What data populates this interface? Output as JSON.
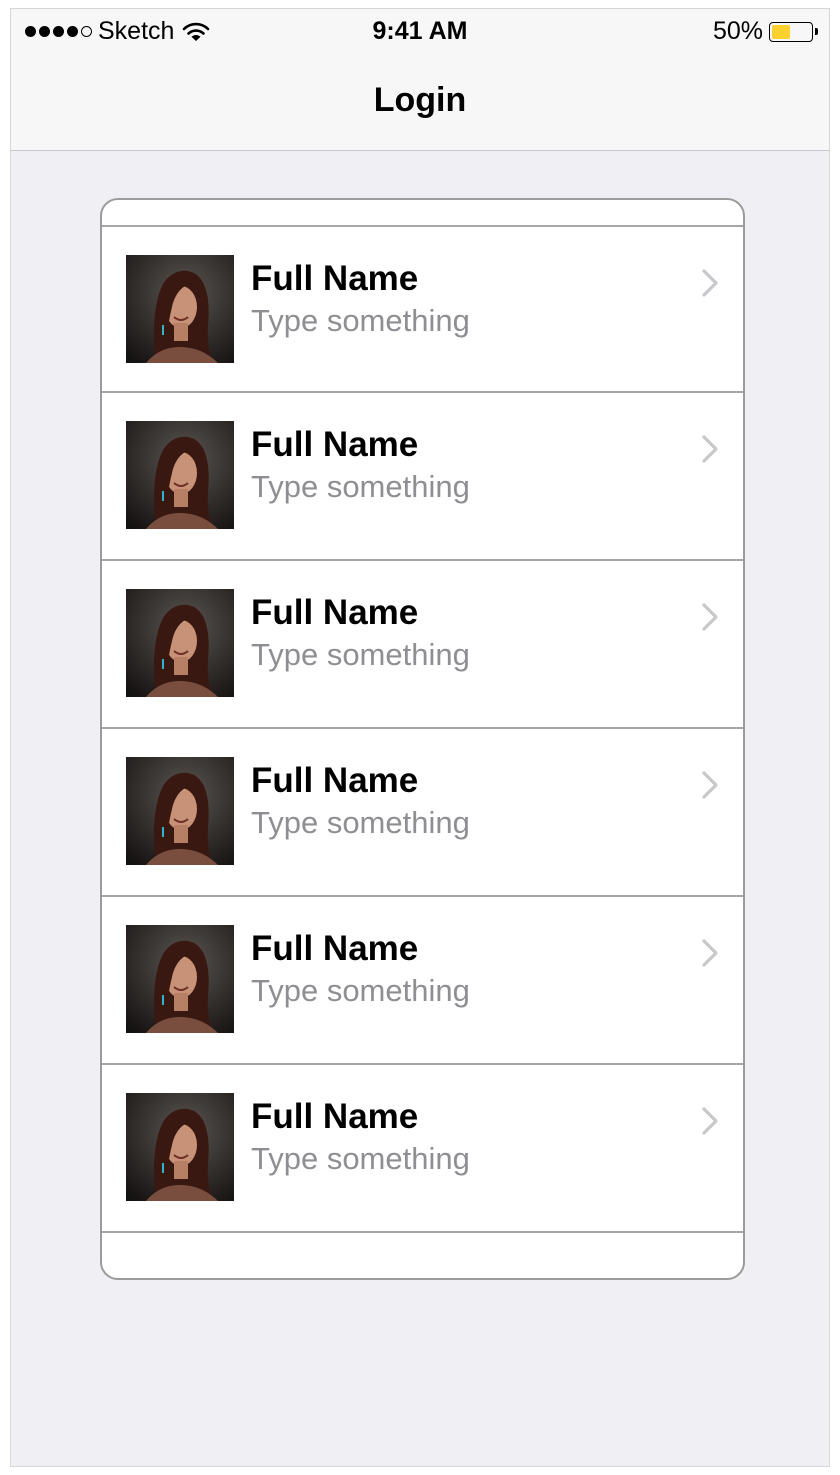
{
  "status_bar": {
    "carrier": "Sketch",
    "time": "9:41 AM",
    "battery_text": "50%",
    "battery_level": 0.5,
    "signal_bars_filled": 4,
    "signal_bars_total": 5,
    "battery_color": "#fcd02f"
  },
  "nav": {
    "title": "Login"
  },
  "list": {
    "items": [
      {
        "title": "Full Name",
        "subtitle": "Type something"
      },
      {
        "title": "Full Name",
        "subtitle": "Type something"
      },
      {
        "title": "Full Name",
        "subtitle": "Type something"
      },
      {
        "title": "Full Name",
        "subtitle": "Type something"
      },
      {
        "title": "Full Name",
        "subtitle": "Type something"
      },
      {
        "title": "Full Name",
        "subtitle": "Type something"
      }
    ]
  },
  "colors": {
    "background": "#efeff4",
    "nav_background": "#f7f7f7",
    "subtitle_text": "#8e8e93",
    "chevron": "#c7c7cc"
  },
  "icons": {
    "row_accessory": "chevron-right-icon",
    "status_wifi": "wifi-icon"
  }
}
